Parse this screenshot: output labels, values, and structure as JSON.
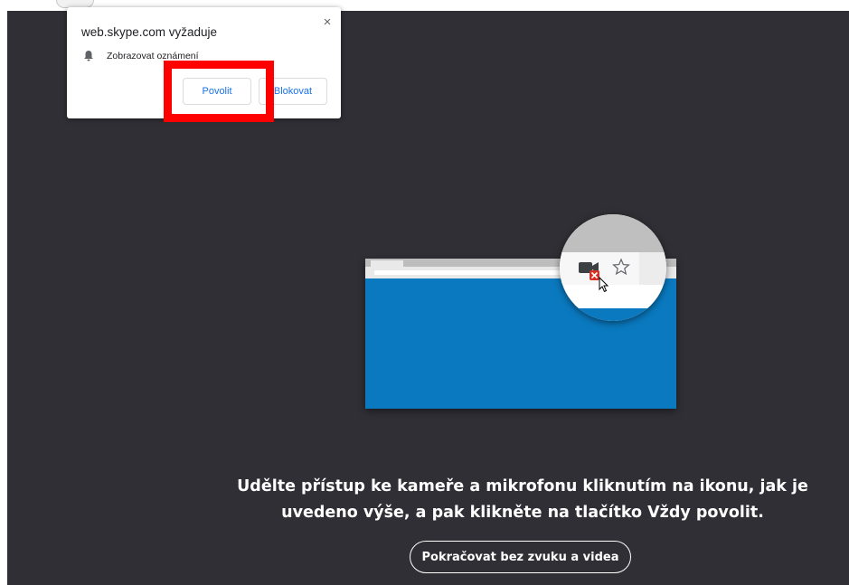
{
  "permission_prompt": {
    "site_requests": "web.skype.com vyžaduje",
    "close_label": "×",
    "notification_label": "Zobrazovat oznámení",
    "allow_label": "Povolit",
    "block_label": "Blokovat"
  },
  "main": {
    "instruction_text": "Udělte přístup ke kameře a mikrofonu kliknutím na ikonu, jak je uvedeno výše, a pak klikněte na tlačítko Vždy povolit.",
    "continue_button": "Pokračovat bez zvuku a videa"
  },
  "icons": {
    "notification": "bell-icon",
    "camera_blocked": "video-camera-blocked-icon",
    "bookmark": "star-icon",
    "pointer": "cursor-icon"
  },
  "colors": {
    "page_background": "#2f2f35",
    "illustration_blue": "#0a79bf",
    "highlight_red": "#ff0000",
    "prompt_button_text": "#1a73e8"
  }
}
